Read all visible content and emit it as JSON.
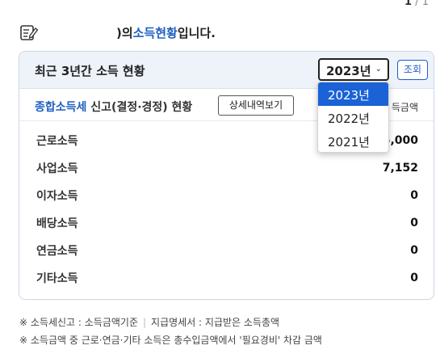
{
  "pager": {
    "current": "1",
    "separator": " / ",
    "total": "1"
  },
  "heading": {
    "suffix_before": ")의 ",
    "highlight": "소득현황",
    "suffix_after": " 입니다."
  },
  "card": {
    "title": "최근 3년간 소득 현황",
    "selected_year": "2023년",
    "query_button": "조회",
    "sub_title_highlight": "종합소득세",
    "sub_title_rest": " 신고(결정·경정) 현황",
    "detail_button": "상세내역보기",
    "column_header": "득금액",
    "rows": [
      {
        "label": "근로소득",
        "value": "5,000"
      },
      {
        "label": "사업소득",
        "value": "7,152"
      },
      {
        "label": "이자소득",
        "value": "0"
      },
      {
        "label": "배당소득",
        "value": "0"
      },
      {
        "label": "연금소득",
        "value": "0"
      },
      {
        "label": "기타소득",
        "value": "0"
      }
    ]
  },
  "dropdown": {
    "options": [
      "2023년",
      "2022년",
      "2021년"
    ],
    "selected_index": 0
  },
  "notes": {
    "line1_a": "※ 소득세신고 : 소득금액기준",
    "line1_sep": "|",
    "line1_b": "지급명세서 : 지급받은 소득총액",
    "line2": "※ 소득금액 중 근로·연금·기타 소득은 총수입금액에서 '필요경비' 차감 금액"
  },
  "colors": {
    "accent": "#1f5fc2",
    "selected": "#1a62d6",
    "header_bg": "#eef3fa"
  },
  "icons": {
    "heading": "document-edit-icon",
    "select": "chevron-down-icon"
  }
}
